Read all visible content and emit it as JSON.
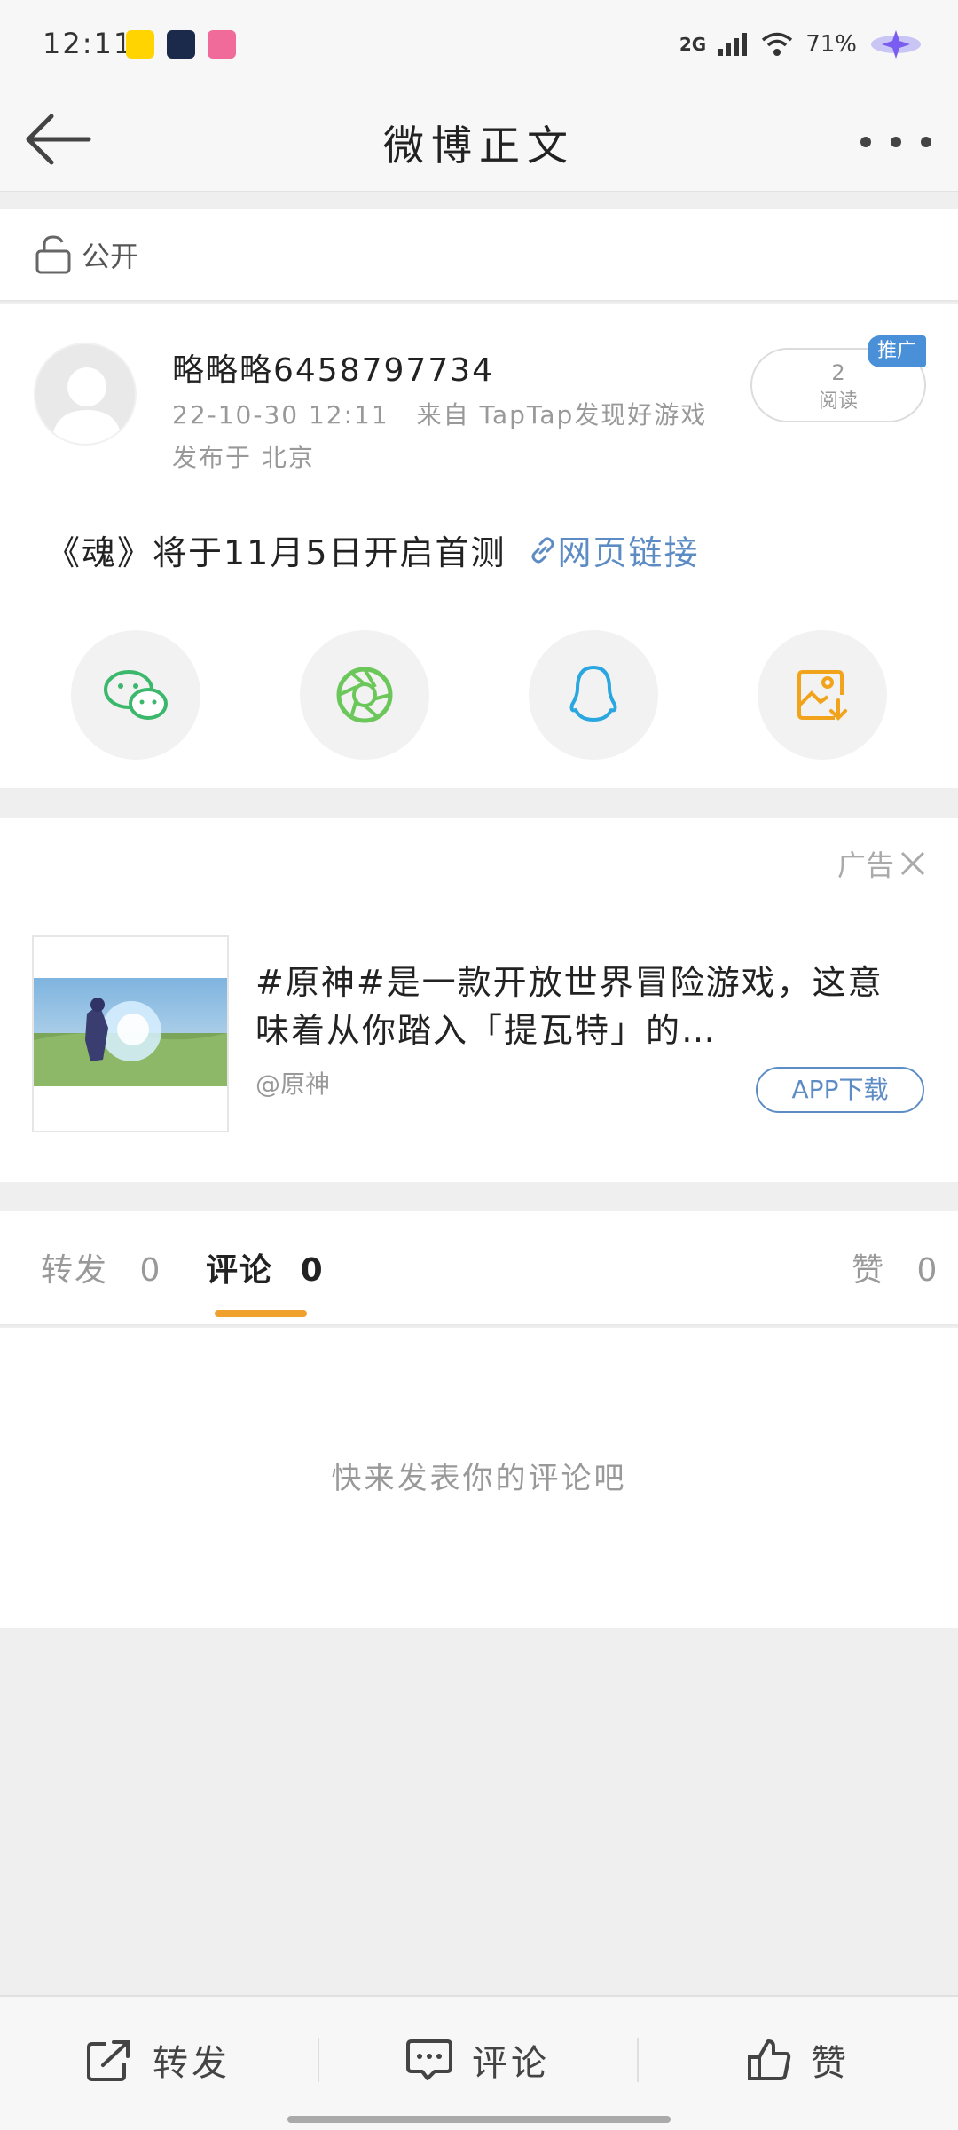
{
  "status_bar": {
    "time": "12:11",
    "network": "2G",
    "battery": "71%"
  },
  "header": {
    "title": "微博正文"
  },
  "visibility": {
    "label": "公开"
  },
  "post": {
    "username": "略略略6458797734",
    "timestamp": "22-10-30 12:11",
    "source": "来自 TapTap发现好游戏",
    "location": "发布于 北京",
    "read_count": "2",
    "read_label": "阅读",
    "promo_badge": "推广",
    "text": "《魂》将于11月5日开启首测",
    "link_text": "网页链接"
  },
  "share": {
    "targets": [
      "wechat",
      "moments",
      "qq",
      "save-image"
    ],
    "colors": {
      "wechat": "#3bb86b",
      "moments": "#6cc75a",
      "qq": "#2aa6e0",
      "save": "#f2a31c"
    }
  },
  "ad": {
    "label": "广告",
    "text": "#原神#是一款开放世界冒险游戏，这意味着从你踏入「提瓦特」的…",
    "source": "@原神",
    "button": "APP下载"
  },
  "tabs": [
    {
      "label": "转发",
      "count": "0"
    },
    {
      "label": "评论",
      "count": "0"
    },
    {
      "label": "赞",
      "count": "0"
    }
  ],
  "empty_state": {
    "message": "快来发表你的评论吧"
  },
  "bottom_bar": {
    "repost": "转发",
    "comment": "评论",
    "like": "赞"
  },
  "accent_color": "#f0a02c",
  "link_color": "#5d8cc4"
}
